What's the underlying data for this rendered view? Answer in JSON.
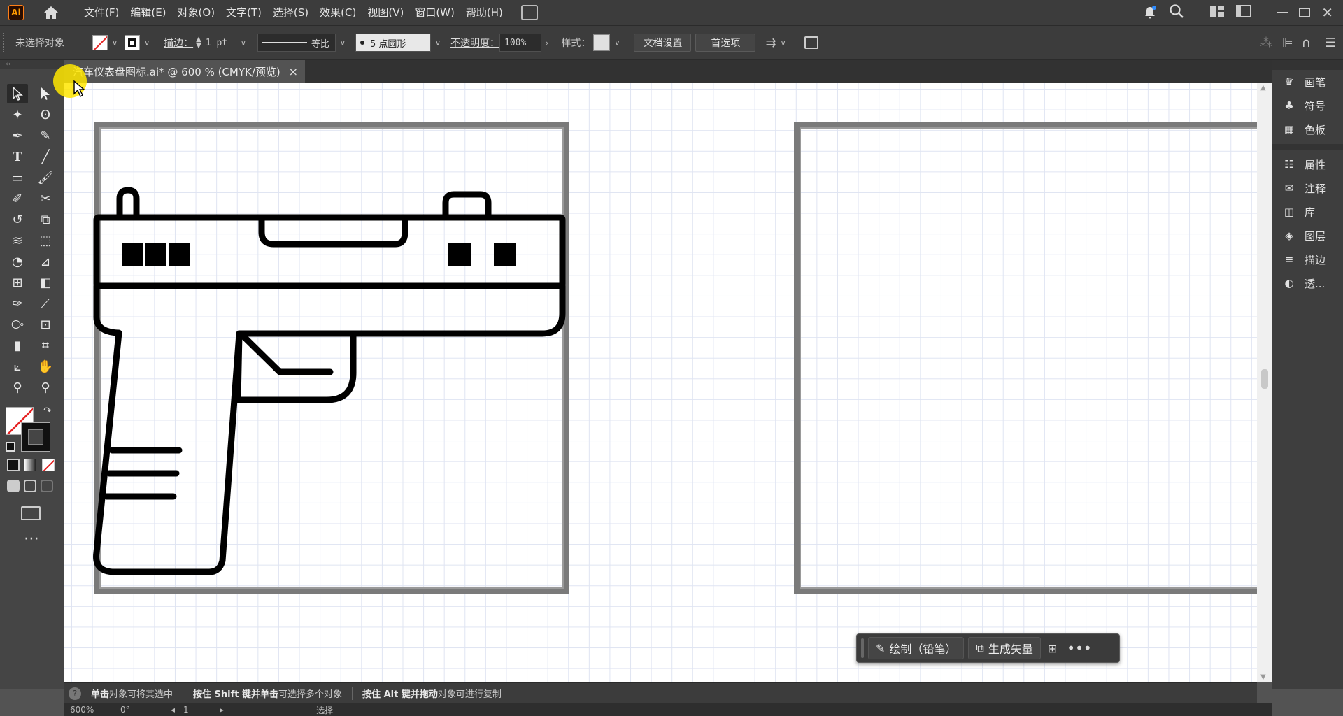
{
  "app": {
    "logo": "Ai",
    "icon_home": "home-icon"
  },
  "menu": [
    "文件(F)",
    "编辑(E)",
    "对象(O)",
    "文字(T)",
    "选择(S)",
    "效果(C)",
    "视图(V)",
    "窗口(W)",
    "帮助(H)"
  ],
  "control": {
    "no_selection": "未选择对象",
    "stroke_label": "描边：",
    "stroke_value": "1 pt",
    "stroke_profile": "等比",
    "brush": "5 点圆形",
    "opacity_label": "不透明度：",
    "opacity_value": "100%",
    "style_label": "样式：",
    "doc_setup": "文档设置",
    "preferences": "首选项"
  },
  "tab": {
    "title": "汽车仪表盘图标.ai* @ 600 % (CMYK/预览)",
    "close": "×"
  },
  "right_panel": {
    "group1": [
      {
        "icon": "brush-icon",
        "label": "画笔"
      },
      {
        "icon": "club-icon",
        "label": "符号"
      },
      {
        "icon": "swatches-icon",
        "label": "色板"
      }
    ],
    "group2": [
      {
        "icon": "properties-icon",
        "label": "属性"
      },
      {
        "icon": "comment-icon",
        "label": "注释"
      },
      {
        "icon": "library-icon",
        "label": "库"
      },
      {
        "icon": "layers-icon",
        "label": "图层"
      },
      {
        "icon": "stroke-icon",
        "label": "描边"
      },
      {
        "icon": "transparency-icon",
        "label": "透..."
      }
    ]
  },
  "taskbar": {
    "draw": "绘制（铅笔）",
    "vectorize": "生成矢量"
  },
  "status": {
    "seg1_bold": "单击",
    "seg1_rest": "对象可将其选中",
    "seg2_a": "按住 Shift 键并单击",
    "seg2_b": "可选择多个对象",
    "seg3_a": "按住 Alt 键并拖动",
    "seg3_b": "对象可进行复制"
  },
  "bottom": {
    "zoom": "600%",
    "angle": "0°",
    "artboard": "1",
    "mode": "选择"
  },
  "colors": {
    "accent": "#ff9a00",
    "artboard_border": "#7a7a7a",
    "grid": "#dfe4f2"
  }
}
